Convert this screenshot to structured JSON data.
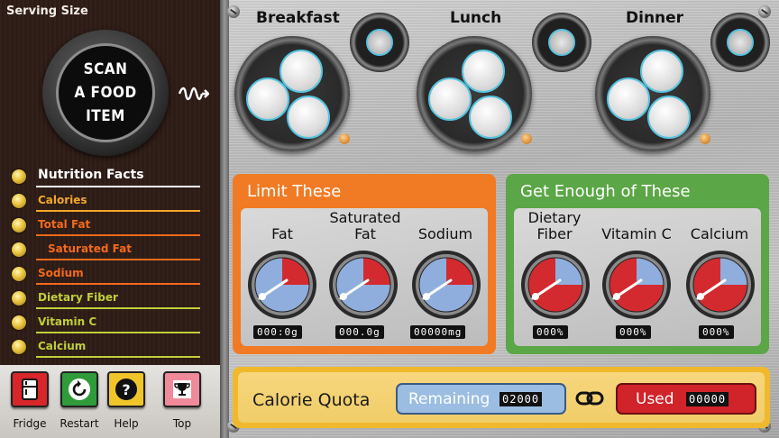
{
  "sidebar": {
    "serving_size_title": "Serving Size",
    "scan_button": [
      "SCAN",
      "A FOOD",
      "ITEM"
    ],
    "nutrition_items": [
      {
        "label": "Nutrition Facts",
        "color": "#ffffff",
        "indent": false
      },
      {
        "label": "Calories",
        "color": "#f3a82a",
        "indent": false
      },
      {
        "label": "Total Fat",
        "color": "#f26a1c",
        "indent": false
      },
      {
        "label": "Saturated Fat",
        "color": "#f26a1c",
        "indent": true
      },
      {
        "label": "Sodium",
        "color": "#f26a1c",
        "indent": false
      },
      {
        "label": "Dietary Fiber",
        "color": "#bfcf3a",
        "indent": false
      },
      {
        "label": "Vitamin C",
        "color": "#bfcf3a",
        "indent": false
      },
      {
        "label": "Calcium",
        "color": "#bfcf3a",
        "indent": false
      }
    ]
  },
  "toolbar": {
    "buttons": [
      {
        "label": "Fridge",
        "icon": "fridge-icon",
        "color": "#d8262a"
      },
      {
        "label": "Restart",
        "icon": "restart-icon",
        "color": "#2f9b3a"
      },
      {
        "label": "Help",
        "icon": "help-icon",
        "color": "#f0c52a"
      },
      {
        "label": "Top",
        "icon": "trophy-icon",
        "color": "#f08a9a"
      }
    ]
  },
  "meals": [
    {
      "label": "Breakfast"
    },
    {
      "label": "Lunch"
    },
    {
      "label": "Dinner"
    }
  ],
  "limit_panel": {
    "title": "Limit These",
    "color": "#f07b24",
    "gauges": [
      {
        "label": "Fat",
        "readout": "000:0g"
      },
      {
        "label": "Saturated Fat",
        "readout": "000.0g"
      },
      {
        "label": "Sodium",
        "readout": "00000mg"
      }
    ]
  },
  "enough_panel": {
    "title": "Get Enough of These",
    "color": "#5ba646",
    "gauges": [
      {
        "label": "Dietary Fiber",
        "readout": "000%"
      },
      {
        "label": "Vitamin C",
        "readout": "000%"
      },
      {
        "label": "Calcium",
        "readout": "000%"
      }
    ]
  },
  "calorie_quota": {
    "title": "Calorie Quota",
    "remaining_label": "Remaining",
    "remaining_value": "02000",
    "used_label": "Used",
    "used_value": "00000"
  }
}
